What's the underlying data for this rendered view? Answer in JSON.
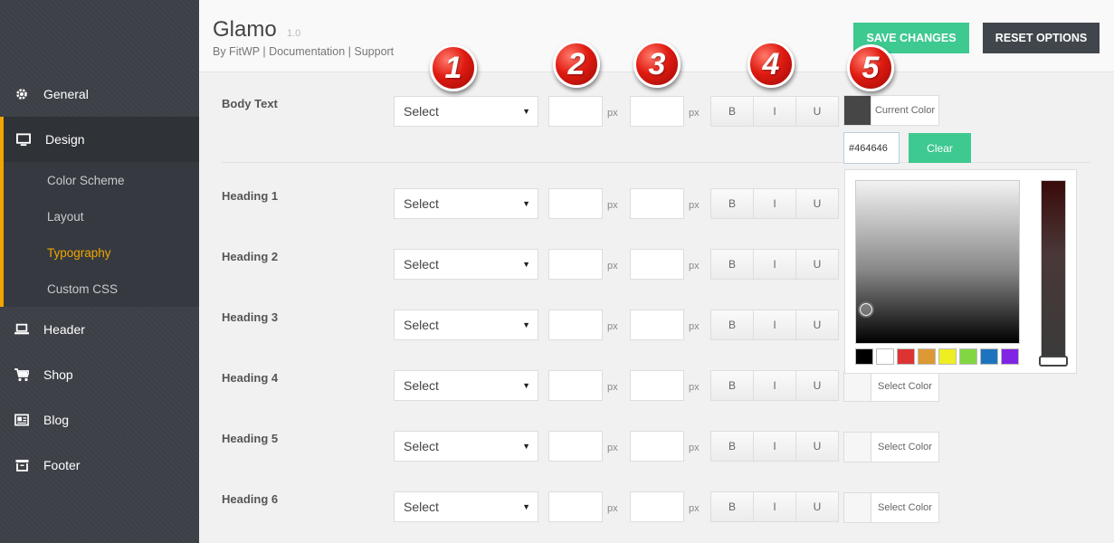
{
  "sidebar": {
    "items": [
      {
        "label": "General",
        "icon": "gear-icon"
      },
      {
        "label": "Design",
        "icon": "monitor-icon"
      },
      {
        "label": "Header",
        "icon": "laptop-icon"
      },
      {
        "label": "Shop",
        "icon": "cart-icon"
      },
      {
        "label": "Blog",
        "icon": "newspaper-icon"
      },
      {
        "label": "Footer",
        "icon": "archive-icon"
      }
    ],
    "submenu": [
      "Color Scheme",
      "Layout",
      "Typography",
      "Custom CSS"
    ],
    "current_submenu": "Typography",
    "accent": "#f0a500"
  },
  "header": {
    "title": "Glamo",
    "version": "1.0",
    "by": "By FitWP",
    "sep": "|",
    "doc_link": "Documentation",
    "support_link": "Support",
    "save_label": "SAVE CHANGES",
    "reset_label": "RESET OPTIONS"
  },
  "common": {
    "select_label": "Select",
    "unit": "px",
    "bold": "B",
    "italic": "I",
    "underline": "U",
    "current_color": "Current Color",
    "select_color": "Select Color"
  },
  "rows": [
    {
      "label": "Body Text"
    },
    {
      "label": "Heading 1"
    },
    {
      "label": "Heading 2"
    },
    {
      "label": "Heading 3"
    },
    {
      "label": "Heading 4"
    },
    {
      "label": "Heading 5"
    },
    {
      "label": "Heading 6"
    }
  ],
  "color_picker": {
    "hex_value": "#464646",
    "clear_label": "Clear",
    "palette": [
      "#000000",
      "#ffffff",
      "#dd3333",
      "#dd9933",
      "#eeee22",
      "#81d742",
      "#1e73be",
      "#8224e3"
    ]
  },
  "badges": [
    "1",
    "2",
    "3",
    "4",
    "5"
  ]
}
